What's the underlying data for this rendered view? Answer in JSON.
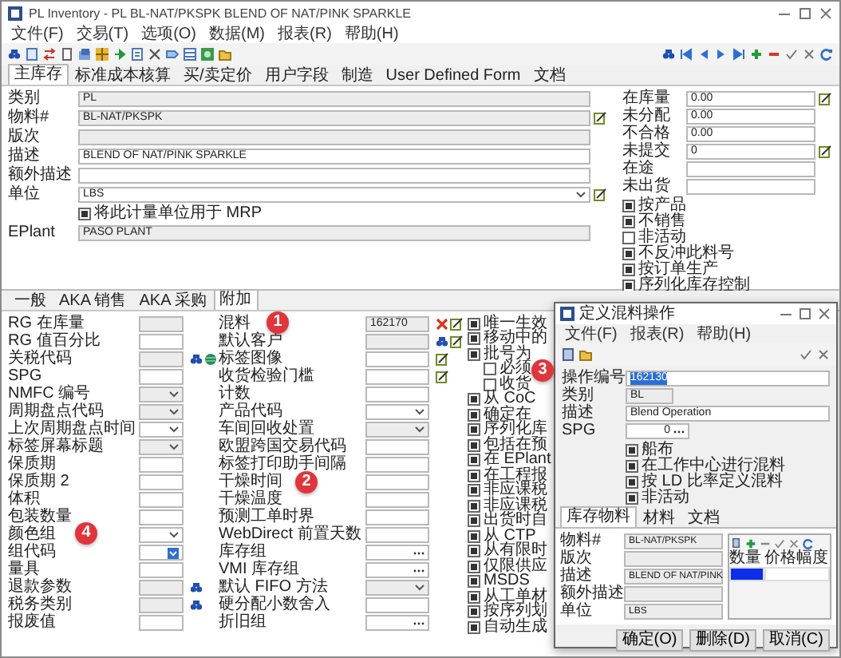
{
  "window": {
    "title": "PL Inventory - PL BL-NAT/PKSPK BLEND OF NAT/PINK SPARKLE"
  },
  "menu": [
    "文件(F)",
    "交易(T)",
    "选项(O)",
    "数据(M)",
    "报表(R)",
    "帮助(H)"
  ],
  "tabs": [
    {
      "label": "主库存",
      "selected": true
    },
    {
      "label": "标准成本核算",
      "selected": false
    },
    {
      "label": "买/卖定价",
      "selected": false
    },
    {
      "label": "用户字段",
      "selected": false
    },
    {
      "label": "制造",
      "selected": false
    },
    {
      "label": "User Defined Form",
      "selected": false
    },
    {
      "label": "文档",
      "selected": false
    }
  ],
  "header": {
    "fields": [
      {
        "label": "类别",
        "value": "PL",
        "kind": "readonly"
      },
      {
        "label": "物料#",
        "value": "BL-NAT/PKSPK",
        "kind": "readonly",
        "tools": [
          {
            "kind": "edit"
          }
        ]
      },
      {
        "label": "版次",
        "kind": "readonly"
      },
      {
        "label": "描述",
        "value": "BLEND OF NAT/PINK SPARKLE",
        "kind": "text"
      },
      {
        "label": "额外描述",
        "kind": "text"
      },
      {
        "label": "单位",
        "value": "LBS",
        "kind": "dropdown",
        "tools": [
          {
            "kind": "edit"
          }
        ]
      }
    ],
    "mrp_checkbox": {
      "label": "将此计量单位用于 MRP",
      "checked": true
    },
    "eplant": {
      "label": "EPlant",
      "value": "PASO PLANT",
      "kind": "readonly"
    },
    "quantities": [
      {
        "label": "在库量",
        "value": "0.00",
        "tools": [
          {
            "kind": "edit"
          }
        ]
      },
      {
        "label": "未分配",
        "value": "0.00"
      },
      {
        "label": "不合格",
        "value": "0.00"
      },
      {
        "label": "未提交",
        "value": "0",
        "tools": [
          {
            "kind": "edit"
          }
        ]
      },
      {
        "label": "在途"
      },
      {
        "label": "未出货"
      }
    ],
    "flags": [
      {
        "label": "按产品",
        "checked": true
      },
      {
        "label": "不销售",
        "checked": true
      },
      {
        "label": "非活动",
        "checked": false
      },
      {
        "label": "不反冲此料号",
        "checked": true
      },
      {
        "label": "按订单生产",
        "checked": true
      },
      {
        "label": "序列化库存控制",
        "checked": true
      }
    ]
  },
  "sub_tabs": [
    {
      "label": "一般",
      "selected": false
    },
    {
      "label": "AKA 销售",
      "selected": false
    },
    {
      "label": "AKA 采购",
      "selected": false
    },
    {
      "label": "附加",
      "selected": true
    }
  ],
  "extra": {
    "column_1": [
      {
        "label": "RG 在库量",
        "kind": "readonly"
      },
      {
        "label": "RG 值百分比",
        "kind": "text"
      },
      {
        "label": "关税代码",
        "kind": "readonly",
        "tools": [
          {
            "kind": "search"
          },
          {
            "kind": "globe"
          }
        ]
      },
      {
        "label": "SPG",
        "kind": "text"
      },
      {
        "label": "NMFC 编号",
        "kind": "dropdown-disabled"
      },
      {
        "label": "周期盘点代码",
        "kind": "dropdown-disabled"
      },
      {
        "label": "上次周期盘点时间",
        "kind": "dropdown"
      },
      {
        "label": "标签屏幕标题",
        "kind": "dropdown-disabled"
      },
      {
        "label": "保质期",
        "kind": "text"
      },
      {
        "label": "保质期 2",
        "kind": "text"
      },
      {
        "label": "体积",
        "kind": "text"
      },
      {
        "label": "包装数量",
        "kind": "text"
      },
      {
        "label": "颜色组",
        "kind": "dropdown"
      },
      {
        "label": "组代码",
        "kind": "combo"
      },
      {
        "label": "量具",
        "kind": "text"
      },
      {
        "label": "退款参数",
        "kind": "readonly",
        "tools": [
          {
            "kind": "search"
          }
        ]
      },
      {
        "label": "税务类别",
        "kind": "readonly",
        "tools": [
          {
            "kind": "search"
          }
        ]
      },
      {
        "label": "报废值",
        "kind": "text"
      }
    ],
    "column_2": [
      {
        "label": "混料",
        "value": "162170",
        "kind": "readonly",
        "tools": [
          {
            "kind": "clear"
          },
          {
            "kind": "edit"
          }
        ]
      },
      {
        "label": "默认客户",
        "kind": "readonly",
        "tools": [
          {
            "kind": "search"
          },
          {
            "kind": "edit"
          }
        ]
      },
      {
        "label": "标签图像",
        "kind": "text",
        "tools": [
          {
            "kind": "edit"
          }
        ]
      },
      {
        "label": "收货检验门槛",
        "kind": "text",
        "tools": [
          {
            "kind": "edit"
          }
        ]
      },
      {
        "label": "计数",
        "kind": "text"
      },
      {
        "label": "产品代码",
        "kind": "dropdown"
      },
      {
        "label": "车间回收处置",
        "kind": "dropdown-disabled"
      },
      {
        "label": "欧盟跨国交易代码",
        "kind": "text"
      },
      {
        "label": "标签打印助手间隔",
        "kind": "text"
      },
      {
        "label": "干燥时间",
        "kind": "text"
      },
      {
        "label": "干燥温度",
        "kind": "text"
      },
      {
        "label": "预测工单时界",
        "kind": "text"
      },
      {
        "label": "WebDirect 前置天数",
        "kind": "text"
      },
      {
        "label": "库存组",
        "kind": "ellipsis"
      },
      {
        "label": "VMI 库存组",
        "kind": "ellipsis"
      },
      {
        "label": "默认 FIFO 方法",
        "kind": "dropdown-disabled"
      },
      {
        "label": "硬分配小数舍入",
        "kind": "text"
      },
      {
        "label": "折旧组",
        "kind": "ellipsis"
      }
    ],
    "options": [
      {
        "label": "唯一生效",
        "checked": true
      },
      {
        "label": "移动中的",
        "checked": true
      },
      {
        "label": "批号为",
        "checked": true,
        "children": [
          {
            "label": "必须",
            "checked": false
          },
          {
            "label": "收货",
            "checked": false
          }
        ]
      },
      {
        "label": "从 CoC",
        "checked": true
      },
      {
        "label": "确定在",
        "checked": true
      },
      {
        "label": "序列化库",
        "checked": true
      },
      {
        "label": "包括在预",
        "checked": true
      },
      {
        "label": "在 EPlant",
        "checked": true
      },
      {
        "label": "在工程报",
        "checked": true
      },
      {
        "label": "非应课税",
        "checked": true
      },
      {
        "label": "非应课税",
        "checked": true
      },
      {
        "label": "出货时自",
        "checked": true
      },
      {
        "label": "从 CTP",
        "checked": true
      },
      {
        "label": "从有限时",
        "checked": true
      },
      {
        "label": "仅限供应",
        "checked": true
      },
      {
        "label": "MSDS",
        "checked": true
      },
      {
        "label": "从工单材",
        "checked": true
      },
      {
        "label": "按序列划",
        "checked": true
      },
      {
        "label": "自动生成",
        "checked": true
      }
    ]
  },
  "dialog": {
    "title": "定义混料操作",
    "menu": [
      "文件(F)",
      "报表(R)",
      "帮助(H)"
    ],
    "fields": [
      {
        "label": "操作编号",
        "value": "162130",
        "kind": "text",
        "highlighted": true
      },
      {
        "label": "类别",
        "value": "BL",
        "kind": "readonly"
      },
      {
        "label": "描述",
        "value": "Blend Operation",
        "kind": "text"
      },
      {
        "label": "SPG",
        "value": "0",
        "kind": "number"
      }
    ],
    "checkboxes": [
      {
        "label": "船布",
        "checked": true
      },
      {
        "label": "在工作中心进行混料",
        "checked": true
      },
      {
        "label": "按 LD 比率定义混料",
        "checked": true
      },
      {
        "label": "非活动",
        "checked": true
      }
    ],
    "tabs": [
      {
        "label": "库存物料",
        "selected": true
      },
      {
        "label": "材料",
        "selected": false
      },
      {
        "label": "文档",
        "selected": false
      }
    ],
    "item_fields": [
      {
        "label": "物料#",
        "value": "BL-NAT/PKSPK"
      },
      {
        "label": "版次"
      },
      {
        "label": "描述",
        "value": "BLEND OF NAT/PINK"
      },
      {
        "label": "额外描述"
      },
      {
        "label": "单位",
        "value": "LBS"
      }
    ],
    "grid": {
      "columns": [
        "数量",
        "价格幅度"
      ],
      "rows": [
        {
          "selected": true
        }
      ]
    },
    "buttons": [
      "确定(O)",
      "删除(D)",
      "取消(C)"
    ]
  },
  "annotations": [
    "1",
    "2",
    "3",
    "4"
  ]
}
